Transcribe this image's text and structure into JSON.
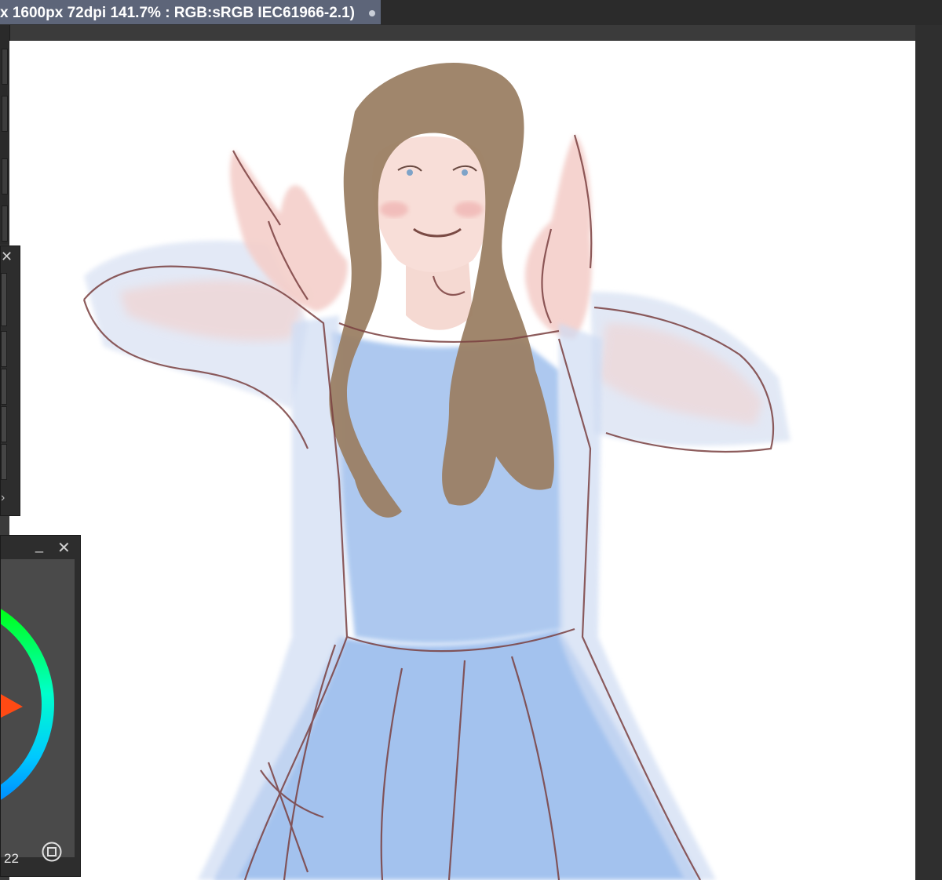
{
  "document_tab": {
    "title": "x 1600px 72dpi 141.7% : RGB:sRGB IEC61966-2.1)",
    "modified_indicator": "●"
  },
  "panels": {
    "top_panel": {
      "close_glyph": "✕",
      "more_glyph": "›"
    },
    "color_panel": {
      "minimize_glyph": "_",
      "close_glyph": "✕",
      "brush_size": "22",
      "ring_colors": [
        "#00ff00",
        "#00ffcc",
        "#00c8ff",
        "#0080ff"
      ],
      "selector_color": "#ff4a14",
      "icon": "square-circle-icon"
    }
  },
  "colors": {
    "canvas": "#ffffff",
    "workspace": "#3b3b3b",
    "tab_active": "#5d6579"
  }
}
